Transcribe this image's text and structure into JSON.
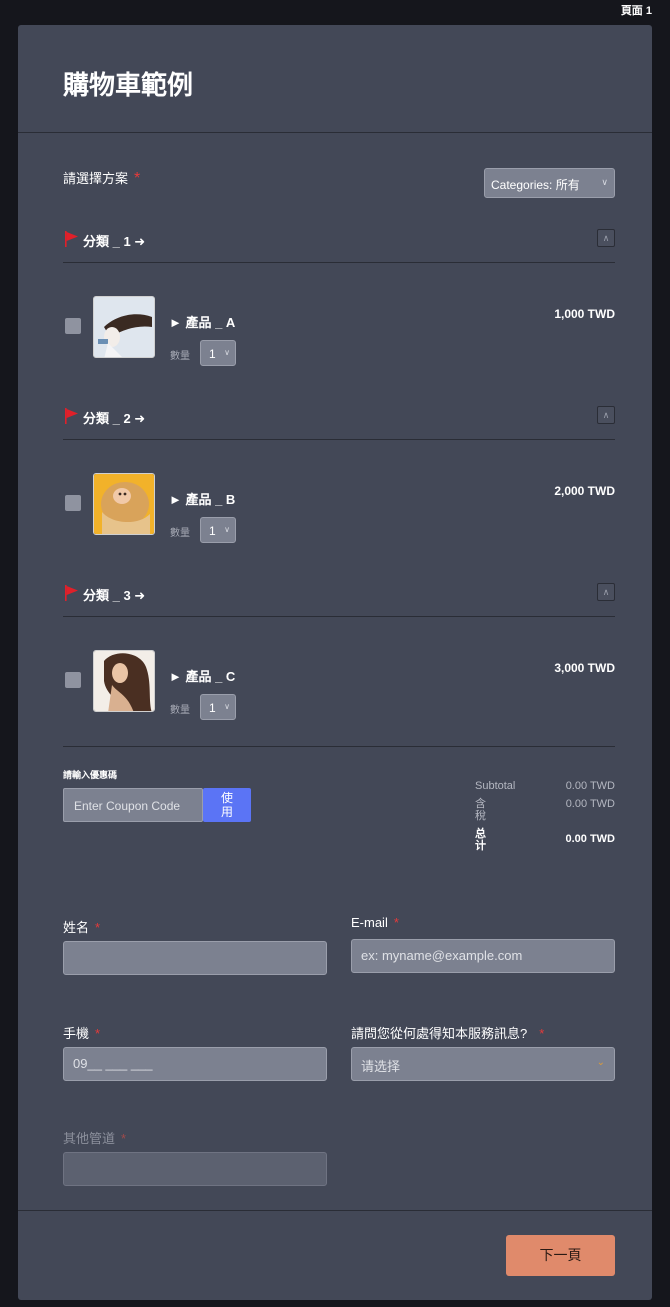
{
  "page_indicator": "頁面 1",
  "form": {
    "title": "購物車範例",
    "plan_label": "請選擇方案",
    "category_filter": "Categories: 所有"
  },
  "categories": [
    {
      "title": "分類 _ 1 ➜",
      "product": {
        "name": "► 產品 _ A",
        "qty_label": "數量",
        "qty": "1",
        "price": "1,000 TWD"
      }
    },
    {
      "title": "分類 _ 2 ➜",
      "product": {
        "name": "► 產品 _ B",
        "qty_label": "數量",
        "qty": "1",
        "price": "2,000 TWD"
      }
    },
    {
      "title": "分類 _ 3 ➜",
      "product": {
        "name": "► 產品 _ C",
        "qty_label": "數量",
        "qty": "1",
        "price": "3,000 TWD"
      }
    }
  ],
  "coupon": {
    "label": "請輸入優惠碼",
    "placeholder": "Enter Coupon Code",
    "button_line1": "使",
    "button_line2": "用"
  },
  "totals": {
    "subtotal_label": "Subtotal",
    "subtotal_value": "0.00 TWD",
    "tax_label_1": "含",
    "tax_label_2": "稅",
    "tax_value": "0.00 TWD",
    "total_label_1": "总",
    "total_label_2": "计",
    "total_value": "0.00 TWD"
  },
  "fields": {
    "name_label": "姓名",
    "email_label": "E-mail",
    "email_placeholder": "ex: myname@example.com",
    "phone_label": "手機",
    "phone_placeholder": "09__ ___ ___",
    "source_label": "請問您從何處得知本服務訊息?",
    "source_placeholder": "请选择",
    "other_label": "其他管道"
  },
  "next_button": "下一頁",
  "colors": {
    "card_bg": "#434857",
    "accent_blue": "#5b74f5",
    "next_button": "#e08a6b",
    "required": "#e63a3a",
    "flag": "#e0202a"
  }
}
